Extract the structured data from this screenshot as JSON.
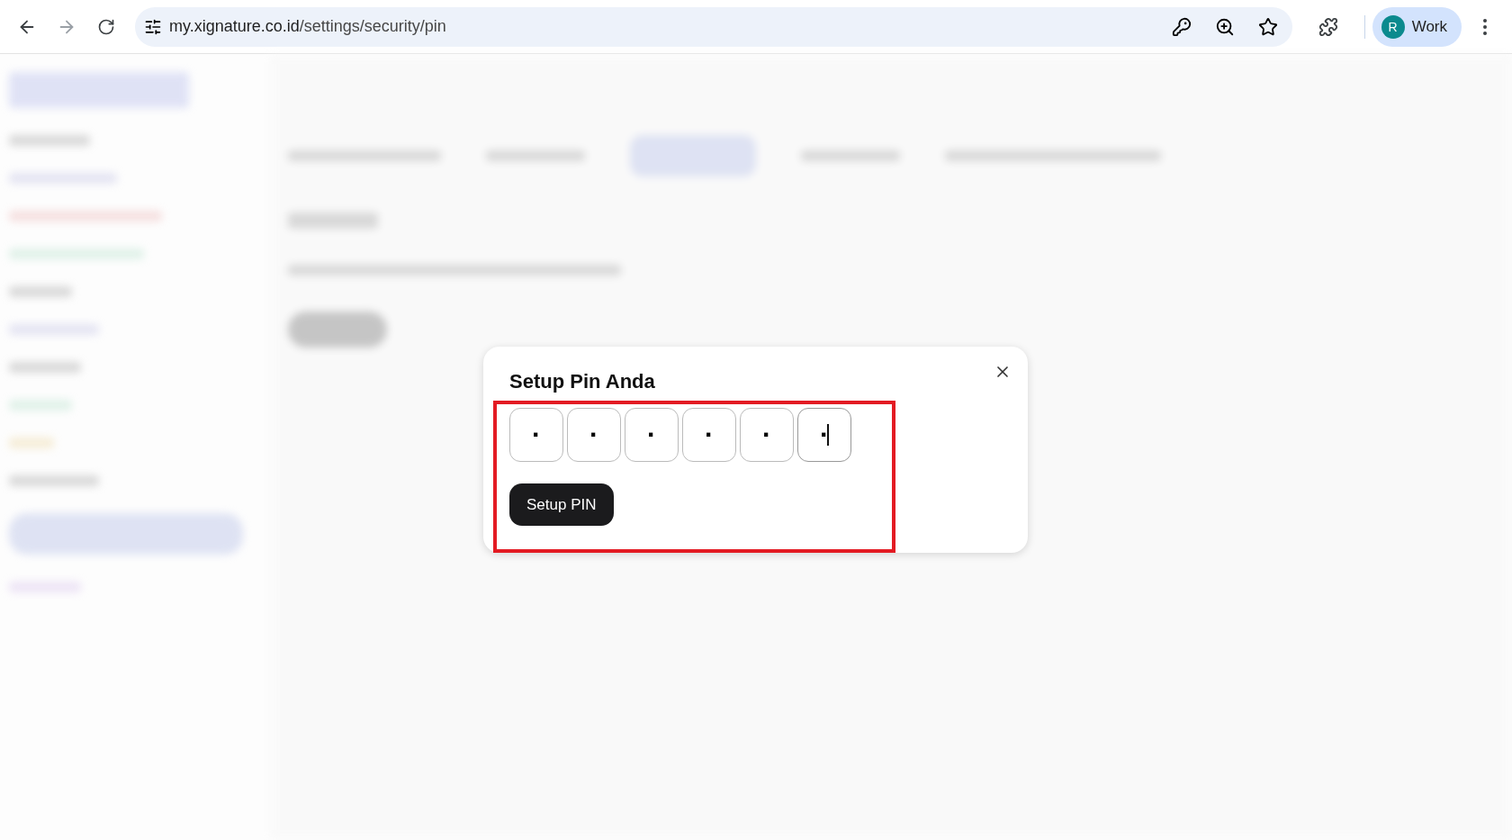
{
  "browser": {
    "url_host": "my.xignature.co.id",
    "url_path": "/settings/security/pin",
    "forward_disabled": true,
    "profile": {
      "initial": "R",
      "label": "Work"
    }
  },
  "dialog": {
    "title": "Setup Pin Anda",
    "digits": [
      {
        "value": "·",
        "focused": false
      },
      {
        "value": "·",
        "focused": false
      },
      {
        "value": "·",
        "focused": false
      },
      {
        "value": "·",
        "focused": false
      },
      {
        "value": "·",
        "focused": false
      },
      {
        "value": "·",
        "focused": true
      }
    ],
    "button": "Setup PIN",
    "highlighted": true
  }
}
